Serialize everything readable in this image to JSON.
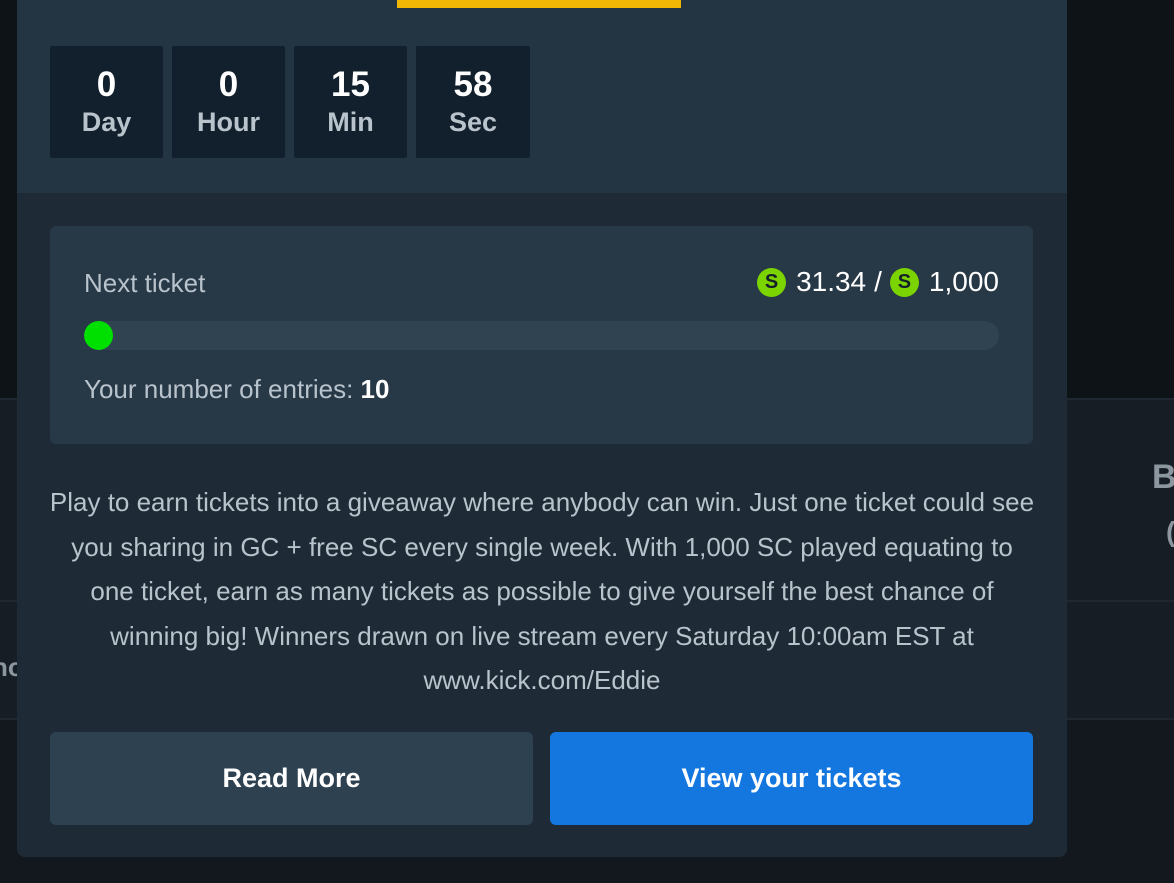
{
  "background": {
    "peek_right_top": "B",
    "peek_right_bottom": "(",
    "peek_left": "no"
  },
  "countdown": [
    {
      "value": "0",
      "unit": "Day"
    },
    {
      "value": "0",
      "unit": "Hour"
    },
    {
      "value": "15",
      "unit": "Min"
    },
    {
      "value": "58",
      "unit": "Sec"
    }
  ],
  "progress": {
    "label": "Next ticket",
    "currency_icon": "S",
    "current": "31.34",
    "separator": "/",
    "target": "1,000",
    "fraction": 0.03134,
    "entries_label": "Your number of entries:",
    "entries_count": "10"
  },
  "description": "Play to earn tickets into a giveaway where anybody can win. Just one ticket could see you sharing in GC + free SC every single week. With 1,000 SC played equating to one ticket, earn as many tickets as possible to give yourself the best chance of winning big! Winners drawn on live stream every Saturday 10:00am EST at www.kick.com/Eddie",
  "buttons": {
    "read_more": "Read More",
    "view_tickets": "View your tickets"
  },
  "colors": {
    "accent_yellow": "#f2b705",
    "progress_green": "#00e000",
    "currency_green": "#7bd300",
    "primary_blue": "#1477e0"
  }
}
